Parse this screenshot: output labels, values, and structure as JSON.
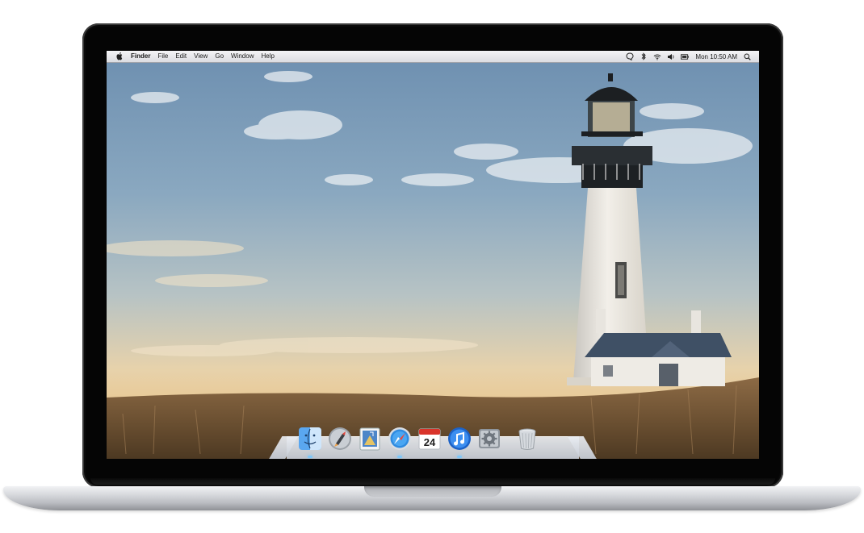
{
  "menubar": {
    "apple_icon": "apple-icon",
    "items": [
      "Finder",
      "File",
      "Edit",
      "View",
      "Go",
      "Window",
      "Help"
    ],
    "status_icons": [
      "chat-icon",
      "bluetooth-icon",
      "wifi-icon",
      "volume-icon",
      "battery-icon"
    ],
    "clock": "Mon 10:50 AM",
    "search_icon": "search-icon"
  },
  "dock": {
    "items": [
      {
        "name": "finder-icon"
      },
      {
        "name": "launchpad-icon"
      },
      {
        "name": "preview-icon"
      },
      {
        "name": "safari-icon"
      },
      {
        "name": "calendar-icon",
        "label": "24"
      },
      {
        "name": "itunes-icon"
      },
      {
        "name": "system-preferences-icon"
      },
      {
        "name": "trash-icon"
      }
    ]
  }
}
